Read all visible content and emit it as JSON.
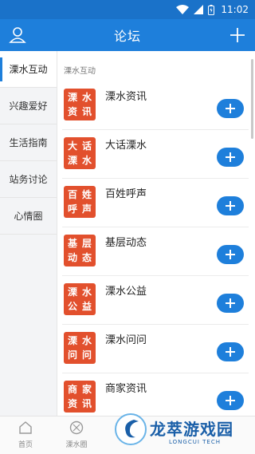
{
  "status_bar": {
    "time": "11:02"
  },
  "header": {
    "title": "论坛"
  },
  "sidebar": {
    "items": [
      {
        "label": "溧水互动",
        "active": true
      },
      {
        "label": "兴趣爱好",
        "active": false
      },
      {
        "label": "生活指南",
        "active": false
      },
      {
        "label": "站务讨论",
        "active": false
      },
      {
        "label": "心情圈",
        "active": false
      }
    ]
  },
  "main": {
    "section_label": "溧水互动",
    "rows": [
      {
        "title": "溧水资讯",
        "badge": [
          "溧",
          "水",
          "资",
          "讯"
        ]
      },
      {
        "title": "大话溧水",
        "badge": [
          "大",
          "话",
          "溧",
          "水"
        ]
      },
      {
        "title": "百姓呼声",
        "badge": [
          "百",
          "姓",
          "呼",
          "声"
        ]
      },
      {
        "title": "基层动态",
        "badge": [
          "基",
          "层",
          "动",
          "态"
        ]
      },
      {
        "title": "溧水公益",
        "badge": [
          "溧",
          "水",
          "公",
          "益"
        ]
      },
      {
        "title": "溧水问问",
        "badge": [
          "溧",
          "水",
          "问",
          "问"
        ]
      },
      {
        "title": "商家资讯",
        "badge": [
          "商",
          "家",
          "资",
          "讯"
        ]
      }
    ]
  },
  "bottom_nav": {
    "items": [
      {
        "label": "首页",
        "icon": "home-icon"
      },
      {
        "label": "溧水圈",
        "icon": "circle-icon"
      }
    ]
  },
  "watermark": {
    "text": "龙萃游戏园",
    "sub": "LONGCUI TECH"
  },
  "colors": {
    "primary": "#1e7fdb",
    "badge": "#e2502d"
  }
}
